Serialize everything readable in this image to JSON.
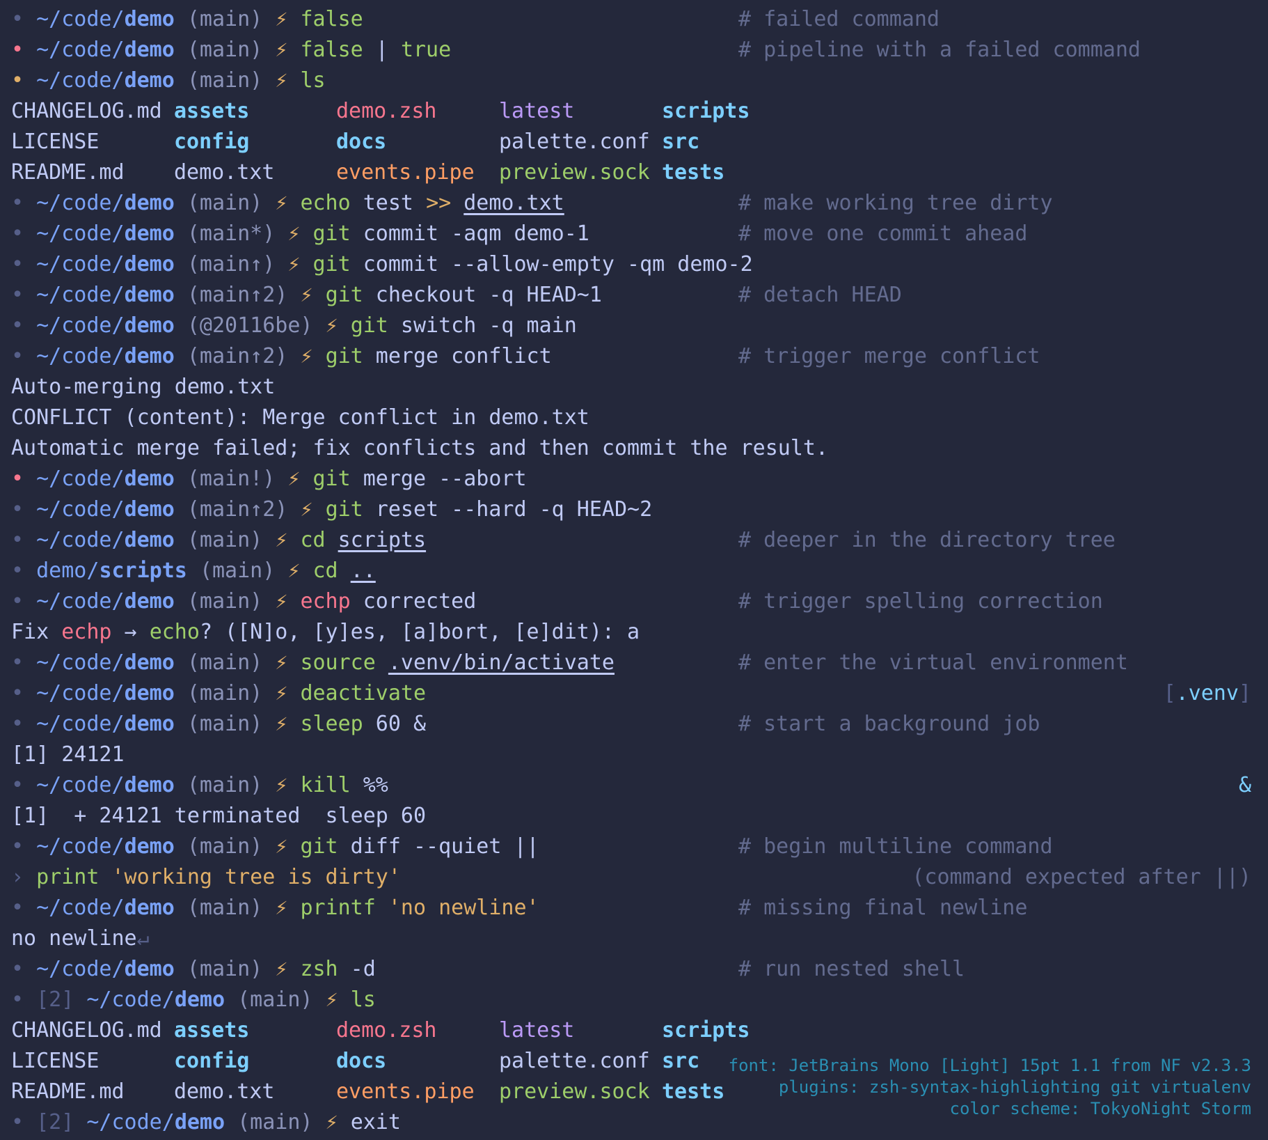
{
  "palette": {
    "background": "#24283b",
    "text": "#c0caf5",
    "dim": "#565f89",
    "path": "#7aa2f7",
    "bolt": "#e0af68",
    "command": "#9ece6a",
    "string": "#e0af68",
    "error": "#f7768e",
    "pipe_file": "#ff9e64",
    "socket_file": "#9ece6a",
    "symlink": "#bb9af7",
    "directory": "#7dcfff",
    "info": "#2a8fb3"
  },
  "lines": [
    {
      "type": "prompt",
      "dot": "•",
      "dot_color": "dim",
      "pre": "~/code/",
      "dir": "demo",
      "branch": "(main)",
      "bolt": "⚡",
      "cmd": [
        [
          "false",
          "cmd"
        ]
      ],
      "comment": "# failed command"
    },
    {
      "type": "prompt",
      "dot": "•",
      "dot_color": "red",
      "pre": "~/code/",
      "dir": "demo",
      "branch": "(main)",
      "bolt": "⚡",
      "cmd": [
        [
          "false",
          "cmd"
        ],
        [
          " | ",
          "text"
        ],
        [
          "true",
          "cmd"
        ]
      ],
      "comment": "# pipeline with a failed command"
    },
    {
      "type": "prompt",
      "dot": "•",
      "dot_color": "bolt",
      "pre": "~/code/",
      "dir": "demo",
      "branch": "(main)",
      "bolt": "⚡",
      "cmd": [
        [
          "ls",
          "cmd"
        ]
      ]
    },
    {
      "type": "ls",
      "cells": [
        [
          "CHANGELOG.md",
          "text"
        ],
        [
          "assets",
          "cyanb"
        ],
        [
          "demo.zsh",
          "red"
        ],
        [
          "latest",
          "purple"
        ],
        [
          "scripts",
          "cyanb"
        ]
      ]
    },
    {
      "type": "ls",
      "cells": [
        [
          "LICENSE",
          "text"
        ],
        [
          "config",
          "cyanb"
        ],
        [
          "docs",
          "cyanb"
        ],
        [
          "palette.conf",
          "text"
        ],
        [
          "src",
          "cyanb"
        ]
      ]
    },
    {
      "type": "ls",
      "cells": [
        [
          "README.md",
          "text"
        ],
        [
          "demo.txt",
          "text"
        ],
        [
          "events.pipe",
          "orange"
        ],
        [
          "preview.sock",
          "green"
        ],
        [
          "tests",
          "cyanb"
        ]
      ]
    },
    {
      "type": "prompt",
      "dot": "•",
      "dot_color": "dim",
      "pre": "~/code/",
      "dir": "demo",
      "branch": "(main)",
      "bolt": "⚡",
      "cmd": [
        [
          "echo",
          "cmd"
        ],
        [
          " test ",
          "text"
        ],
        [
          ">>",
          "str"
        ],
        [
          " ",
          "text"
        ],
        [
          "demo.txt",
          "text ul"
        ]
      ],
      "comment": "# make working tree dirty"
    },
    {
      "type": "prompt",
      "dot": "•",
      "dot_color": "dim",
      "pre": "~/code/",
      "dir": "demo",
      "branch": "(main*)",
      "bolt": "⚡",
      "cmd": [
        [
          "git",
          "cmd"
        ],
        [
          " commit -aqm demo-1",
          "text"
        ]
      ],
      "comment": "# move one commit ahead"
    },
    {
      "type": "prompt",
      "dot": "•",
      "dot_color": "dim",
      "pre": "~/code/",
      "dir": "demo",
      "branch": "(main↑)",
      "bolt": "⚡",
      "cmd": [
        [
          "git",
          "cmd"
        ],
        [
          " commit --allow-empty -qm demo-2",
          "text"
        ]
      ]
    },
    {
      "type": "prompt",
      "dot": "•",
      "dot_color": "dim",
      "pre": "~/code/",
      "dir": "demo",
      "branch": "(main↑2)",
      "bolt": "⚡",
      "cmd": [
        [
          "git",
          "cmd"
        ],
        [
          " checkout -q HEAD~1",
          "text"
        ]
      ],
      "comment": "# detach HEAD"
    },
    {
      "type": "prompt",
      "dot": "•",
      "dot_color": "dim",
      "pre": "~/code/",
      "dir": "demo",
      "branch": "(@20116be)",
      "bolt": "⚡",
      "cmd": [
        [
          "git",
          "cmd"
        ],
        [
          " switch -q main",
          "text"
        ]
      ]
    },
    {
      "type": "prompt",
      "dot": "•",
      "dot_color": "dim",
      "pre": "~/code/",
      "dir": "demo",
      "branch": "(main↑2)",
      "bolt": "⚡",
      "cmd": [
        [
          "git",
          "cmd"
        ],
        [
          " merge conflict",
          "text"
        ]
      ],
      "comment": "# trigger merge conflict"
    },
    {
      "type": "out",
      "segs": [
        [
          "Auto-merging demo.txt",
          "text"
        ]
      ]
    },
    {
      "type": "out",
      "segs": [
        [
          "CONFLICT (content): Merge conflict in demo.txt",
          "text"
        ]
      ]
    },
    {
      "type": "out",
      "segs": [
        [
          "Automatic merge failed; fix conflicts and then commit the result.",
          "text"
        ]
      ]
    },
    {
      "type": "prompt",
      "dot": "•",
      "dot_color": "red",
      "pre": "~/code/",
      "dir": "demo",
      "branch": "(main!)",
      "bolt": "⚡",
      "cmd": [
        [
          "git",
          "cmd"
        ],
        [
          " merge --abort",
          "text"
        ]
      ]
    },
    {
      "type": "prompt",
      "dot": "•",
      "dot_color": "dim",
      "pre": "~/code/",
      "dir": "demo",
      "branch": "(main↑2)",
      "bolt": "⚡",
      "cmd": [
        [
          "git",
          "cmd"
        ],
        [
          " reset --hard -q HEAD~2",
          "text"
        ]
      ]
    },
    {
      "type": "prompt",
      "dot": "•",
      "dot_color": "dim",
      "pre": "~/code/",
      "dir": "demo",
      "branch": "(main)",
      "bolt": "⚡",
      "cmd": [
        [
          "cd",
          "cmd"
        ],
        [
          " ",
          "text"
        ],
        [
          "scripts",
          "text ul"
        ]
      ],
      "comment": "# deeper in the directory tree"
    },
    {
      "type": "prompt",
      "dot": "•",
      "dot_color": "dim",
      "pre": "demo/",
      "dir": "scripts",
      "branch": "(main)",
      "bolt": "⚡",
      "cmd": [
        [
          "cd",
          "cmd"
        ],
        [
          " ",
          "text"
        ],
        [
          "..",
          "text ul"
        ]
      ]
    },
    {
      "type": "prompt",
      "dot": "•",
      "dot_color": "dim",
      "pre": "~/code/",
      "dir": "demo",
      "branch": "(main)",
      "bolt": "⚡",
      "cmd": [
        [
          "echp",
          "red"
        ],
        [
          " corrected",
          "text"
        ]
      ],
      "comment": "# trigger spelling correction"
    },
    {
      "type": "out",
      "segs": [
        [
          "Fix ",
          "text"
        ],
        [
          "echp",
          "red"
        ],
        [
          " → ",
          "text"
        ],
        [
          "echo",
          "cmd"
        ],
        [
          "? ([N]o, [y]es, [a]bort, [e]dit): a",
          "text"
        ]
      ]
    },
    {
      "type": "prompt",
      "dot": "•",
      "dot_color": "dim",
      "pre": "~/code/",
      "dir": "demo",
      "branch": "(main)",
      "bolt": "⚡",
      "cmd": [
        [
          "source",
          "cmd"
        ],
        [
          " ",
          "text"
        ],
        [
          ".venv/bin/activate",
          "text ul"
        ]
      ],
      "comment": "# enter the virtual environment"
    },
    {
      "type": "prompt",
      "dot": "•",
      "dot_color": "dim",
      "pre": "~/code/",
      "dir": "demo",
      "branch": "(main)",
      "bolt": "⚡",
      "cmd": [
        [
          "deactivate",
          "cmd"
        ]
      ],
      "right": [
        [
          "[",
          "dim"
        ],
        [
          ".venv",
          "link"
        ],
        [
          "]",
          "dim"
        ]
      ]
    },
    {
      "type": "prompt",
      "dot": "•",
      "dot_color": "dim",
      "pre": "~/code/",
      "dir": "demo",
      "branch": "(main)",
      "bolt": "⚡",
      "cmd": [
        [
          "sleep",
          "cmd"
        ],
        [
          " 60 ",
          "text"
        ],
        [
          "&",
          "text"
        ]
      ],
      "comment": "# start a background job"
    },
    {
      "type": "out",
      "segs": [
        [
          "[1] 24121",
          "text"
        ]
      ]
    },
    {
      "type": "prompt",
      "dot": "•",
      "dot_color": "dim",
      "pre": "~/code/",
      "dir": "demo",
      "branch": "(main)",
      "bolt": "⚡",
      "cmd": [
        [
          "kill",
          "cmd"
        ],
        [
          " %%",
          "text"
        ]
      ],
      "right": [
        [
          "&",
          "link"
        ]
      ]
    },
    {
      "type": "out",
      "segs": [
        [
          "[1]  + 24121 terminated  sleep 60",
          "text"
        ]
      ]
    },
    {
      "type": "prompt",
      "dot": "•",
      "dot_color": "dim",
      "pre": "~/code/",
      "dir": "demo",
      "branch": "(main)",
      "bolt": "⚡",
      "cmd": [
        [
          "git",
          "cmd"
        ],
        [
          " diff --quiet ||",
          "text"
        ]
      ],
      "comment": "# begin multiline command"
    },
    {
      "type": "out",
      "segs": [
        [
          "› ",
          "dim"
        ],
        [
          "print",
          "cmd"
        ],
        [
          " ",
          "text"
        ],
        [
          "'working tree is dirty'",
          "str"
        ]
      ],
      "right": [
        [
          "(command expected after ||)",
          "comment"
        ]
      ]
    },
    {
      "type": "prompt",
      "dot": "•",
      "dot_color": "dim",
      "pre": "~/code/",
      "dir": "demo",
      "branch": "(main)",
      "bolt": "⚡",
      "cmd": [
        [
          "printf",
          "cmd"
        ],
        [
          " ",
          "text"
        ],
        [
          "'no newline'",
          "str"
        ]
      ],
      "comment": "# missing final newline"
    },
    {
      "type": "out",
      "segs": [
        [
          "no newline",
          "text"
        ],
        [
          "↵",
          "dim"
        ]
      ]
    },
    {
      "type": "prompt",
      "dot": "•",
      "dot_color": "dim",
      "pre": "~/code/",
      "dir": "demo",
      "branch": "(main)",
      "bolt": "⚡",
      "cmd": [
        [
          "zsh",
          "cmd"
        ],
        [
          " -d",
          "text"
        ]
      ],
      "comment": "# run nested shell"
    },
    {
      "type": "prompt",
      "dot": "•",
      "dot_color": "dim",
      "level": "[2]",
      "pre": "~/code/",
      "dir": "demo",
      "branch": "(main)",
      "bolt": "⚡",
      "cmd": [
        [
          "ls",
          "cmd"
        ]
      ]
    },
    {
      "type": "ls",
      "cells": [
        [
          "CHANGELOG.md",
          "text"
        ],
        [
          "assets",
          "cyanb"
        ],
        [
          "demo.zsh",
          "red"
        ],
        [
          "latest",
          "purple"
        ],
        [
          "scripts",
          "cyanb"
        ]
      ]
    },
    {
      "type": "ls",
      "cells": [
        [
          "LICENSE",
          "text"
        ],
        [
          "config",
          "cyanb"
        ],
        [
          "docs",
          "cyanb"
        ],
        [
          "palette.conf",
          "text"
        ],
        [
          "src",
          "cyanb"
        ]
      ]
    },
    {
      "type": "ls",
      "cells": [
        [
          "README.md",
          "text"
        ],
        [
          "demo.txt",
          "text"
        ],
        [
          "events.pipe",
          "orange"
        ],
        [
          "preview.sock",
          "green"
        ],
        [
          "tests",
          "cyanb"
        ]
      ]
    },
    {
      "type": "prompt",
      "dot": "•",
      "dot_color": "dim",
      "level": "[2]",
      "pre": "~/code/",
      "dir": "demo",
      "branch": "(main)",
      "bolt": "⚡",
      "cmd": [
        [
          "exit",
          "text"
        ]
      ]
    }
  ],
  "info": {
    "font": "font: JetBrains Mono [Light] 15pt 1.1 from NF v2.3.3",
    "plugins": "plugins: zsh-syntax-highlighting git virtualenv",
    "scheme": "color scheme: TokyoNight Storm"
  }
}
